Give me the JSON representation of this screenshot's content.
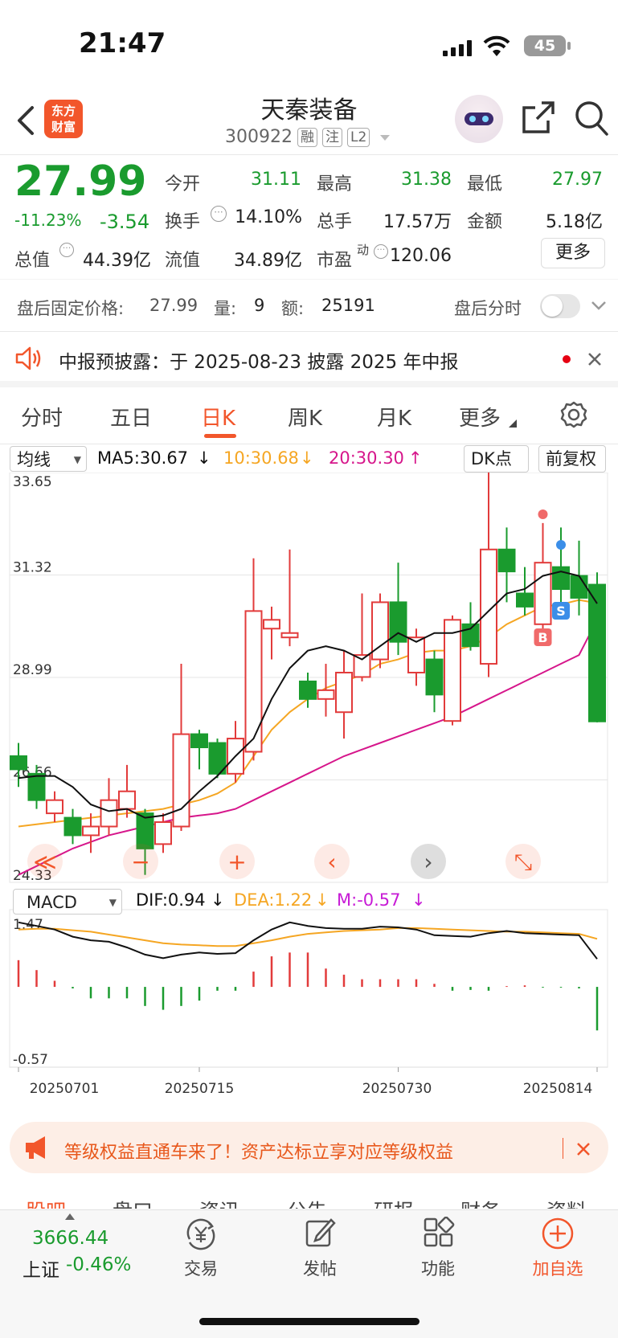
{
  "status_bar": {
    "time": "21:47",
    "battery": "45"
  },
  "header": {
    "logo_text_line1": "东方",
    "logo_text_line2": "财富",
    "stock_name": "天秦装备",
    "stock_code": "300922",
    "tags": [
      "融",
      "注",
      "L2"
    ]
  },
  "quote": {
    "price": "27.99",
    "change_pct": "-11.23%",
    "change_amt": "-3.54",
    "open_label": "今开",
    "open": "31.11",
    "high_label": "最高",
    "high": "31.38",
    "low_label": "最低",
    "low": "27.97",
    "turnover_label": "换手",
    "turnover": "14.10%",
    "volume_label": "总手",
    "volume": "17.57万",
    "amount_label": "金额",
    "amount": "5.18亿",
    "mktcap_label": "总值",
    "mktcap": "44.39亿",
    "float_label": "流值",
    "float_cap": "34.89亿",
    "pe_label": "市盈",
    "pe_sup": "动",
    "pe": "120.06",
    "more_label": "更多"
  },
  "after_hours": {
    "price_label": "盘后固定价格:",
    "price": "27.99",
    "vol_label": "量:",
    "vol": "9",
    "amt_label": "额:",
    "amt": "25191",
    "timeshare_label": "盘后分时"
  },
  "notice": {
    "text": "中报预披露：于 2025-08-23 披露 2025 年中报"
  },
  "period_tabs": [
    "分时",
    "五日",
    "日K",
    "周K",
    "月K",
    "更多"
  ],
  "active_tab": "日K",
  "ma_bar": {
    "selector": "均线",
    "ma5": "MA5:30.67",
    "ma10": "10:30.68",
    "ma20": "20:30.30",
    "dk_label": "DK点",
    "adjust_label": "前复权"
  },
  "macd_bar": {
    "selector": "MACD",
    "dif": "DIF:0.94",
    "dea": "DEA:1.22",
    "m": "M:-0.57"
  },
  "colors": {
    "up": "#e23b3b",
    "down": "#1a9b2e",
    "ma5": "#111111",
    "ma10": "#f5a623",
    "ma20": "#d6168b",
    "accent": "#f2562b"
  },
  "chart_data": {
    "type": "candlestick",
    "y_ticks": [
      "33.65",
      "31.32",
      "28.99",
      "26.66",
      "24.33"
    ],
    "ylim": [
      24.33,
      33.65
    ],
    "x_ticks": [
      "20250701",
      "20250715",
      "20250730",
      "20250814"
    ],
    "candles": [
      {
        "o": 27.2,
        "c": 26.9,
        "h": 27.5,
        "l": 26.5
      },
      {
        "o": 26.8,
        "c": 26.2,
        "h": 27.0,
        "l": 26.0
      },
      {
        "o": 25.9,
        "c": 26.2,
        "h": 26.4,
        "l": 25.7
      },
      {
        "o": 25.8,
        "c": 25.4,
        "h": 26.0,
        "l": 25.2
      },
      {
        "o": 25.4,
        "c": 25.6,
        "h": 25.9,
        "l": 25.0
      },
      {
        "o": 25.6,
        "c": 26.2,
        "h": 26.7,
        "l": 25.4
      },
      {
        "o": 26.0,
        "c": 26.4,
        "h": 27.0,
        "l": 25.8
      },
      {
        "o": 25.9,
        "c": 25.1,
        "h": 26.0,
        "l": 24.5
      },
      {
        "o": 25.2,
        "c": 25.7,
        "h": 25.9,
        "l": 25.0
      },
      {
        "o": 25.6,
        "c": 27.7,
        "h": 29.3,
        "l": 25.5
      },
      {
        "o": 27.7,
        "c": 27.4,
        "h": 27.8,
        "l": 26.9
      },
      {
        "o": 27.5,
        "c": 26.8,
        "h": 27.6,
        "l": 26.7
      },
      {
        "o": 26.8,
        "c": 27.6,
        "h": 28.0,
        "l": 26.6
      },
      {
        "o": 27.3,
        "c": 30.5,
        "h": 31.7,
        "l": 27.1
      },
      {
        "o": 30.1,
        "c": 30.3,
        "h": 30.6,
        "l": 29.4
      },
      {
        "o": 29.9,
        "c": 30.0,
        "h": 31.9,
        "l": 29.7
      },
      {
        "o": 28.9,
        "c": 28.5,
        "h": 29.1,
        "l": 28.3
      },
      {
        "o": 28.5,
        "c": 28.7,
        "h": 29.3,
        "l": 28.1
      },
      {
        "o": 28.2,
        "c": 29.1,
        "h": 29.6,
        "l": 27.6
      },
      {
        "o": 29.0,
        "c": 29.5,
        "h": 30.9,
        "l": 28.9
      },
      {
        "o": 29.4,
        "c": 30.7,
        "h": 30.9,
        "l": 29.2
      },
      {
        "o": 30.7,
        "c": 29.8,
        "h": 31.6,
        "l": 29.5
      },
      {
        "o": 29.1,
        "c": 29.9,
        "h": 30.1,
        "l": 28.8
      },
      {
        "o": 29.4,
        "c": 28.6,
        "h": 29.6,
        "l": 28.2
      },
      {
        "o": 28.0,
        "c": 30.3,
        "h": 30.4,
        "l": 27.9
      },
      {
        "o": 30.2,
        "c": 29.7,
        "h": 30.7,
        "l": 29.6
      },
      {
        "o": 29.3,
        "c": 31.9,
        "h": 33.65,
        "l": 29.0
      },
      {
        "o": 31.9,
        "c": 31.4,
        "h": 32.4,
        "l": 30.7
      },
      {
        "o": 30.9,
        "c": 30.6,
        "h": 31.5,
        "l": 30.4
      },
      {
        "o": 30.2,
        "c": 31.6,
        "h": 32.5,
        "l": 30.1
      },
      {
        "o": 31.5,
        "c": 31.0,
        "h": 32.4,
        "l": 30.5
      },
      {
        "o": 31.3,
        "c": 30.8,
        "h": 32.1,
        "l": 30.4
      },
      {
        "o": 31.1,
        "c": 27.99,
        "h": 31.38,
        "l": 27.97
      }
    ],
    "ma5": [
      26.7,
      26.75,
      26.75,
      26.5,
      26.1,
      25.95,
      26.0,
      25.8,
      25.85,
      26.0,
      26.4,
      26.75,
      27.2,
      27.6,
      28.5,
      29.2,
      29.6,
      29.7,
      29.6,
      29.4,
      29.7,
      30.0,
      29.8,
      30.0,
      30.0,
      30.1,
      30.5,
      30.9,
      31.0,
      31.3,
      31.4,
      31.3,
      30.67
    ],
    "ma10": [
      25.6,
      25.65,
      25.7,
      25.75,
      25.8,
      25.85,
      25.9,
      25.95,
      26.0,
      26.1,
      26.2,
      26.35,
      26.6,
      27.2,
      27.8,
      28.2,
      28.5,
      28.75,
      28.9,
      29.05,
      29.3,
      29.4,
      29.55,
      29.6,
      29.6,
      29.7,
      29.9,
      30.2,
      30.4,
      30.6,
      30.65,
      30.75,
      30.68
    ],
    "ma20": [
      24.5,
      24.7,
      24.9,
      25.1,
      25.25,
      25.4,
      25.5,
      25.6,
      25.7,
      25.8,
      25.85,
      25.9,
      26.0,
      26.2,
      26.4,
      26.6,
      26.8,
      27.0,
      27.2,
      27.35,
      27.5,
      27.65,
      27.8,
      27.95,
      28.1,
      28.3,
      28.5,
      28.7,
      28.9,
      29.1,
      29.3,
      29.5,
      30.3
    ],
    "macd_ylim": [
      -0.57,
      1.47
    ],
    "dif": [
      1.45,
      1.4,
      1.35,
      1.25,
      1.2,
      1.18,
      1.1,
      1.0,
      0.95,
      1.0,
      1.03,
      1.01,
      1.02,
      1.2,
      1.35,
      1.45,
      1.4,
      1.37,
      1.36,
      1.36,
      1.39,
      1.38,
      1.35,
      1.27,
      1.26,
      1.25,
      1.3,
      1.33,
      1.3,
      1.29,
      1.28,
      1.27,
      0.94
    ],
    "dea": [
      1.35,
      1.36,
      1.36,
      1.34,
      1.32,
      1.28,
      1.24,
      1.2,
      1.16,
      1.14,
      1.13,
      1.12,
      1.12,
      1.16,
      1.2,
      1.25,
      1.29,
      1.31,
      1.33,
      1.34,
      1.35,
      1.37,
      1.37,
      1.36,
      1.35,
      1.34,
      1.33,
      1.32,
      1.32,
      1.31,
      1.3,
      1.29,
      1.22
    ],
    "macd_hist": [
      0.35,
      0.22,
      0.08,
      -0.02,
      -0.15,
      -0.15,
      -0.15,
      -0.25,
      -0.3,
      -0.25,
      -0.18,
      -0.05,
      -0.05,
      0.2,
      0.4,
      0.45,
      0.45,
      0.24,
      0.16,
      0.1,
      0.1,
      0.1,
      0.1,
      0.04,
      -0.05,
      -0.04,
      -0.05,
      0.01,
      0.02,
      -0.01,
      -0.01,
      -0.02,
      -0.57
    ],
    "markers": [
      {
        "label": "B",
        "index": 29
      },
      {
        "label": "S",
        "index": 30
      }
    ]
  },
  "banner": {
    "text": "等级权益直通车来了！资产达标立享对应等级权益"
  },
  "section_tabs": [
    "股吧",
    "盘口",
    "资讯",
    "公告",
    "研报",
    "财务",
    "资料"
  ],
  "bottom_nav": {
    "index_value": "3666.44",
    "index_name": "上证",
    "index_change": "-0.46%",
    "items": [
      "交易",
      "发帖",
      "功能",
      "加自选"
    ]
  }
}
